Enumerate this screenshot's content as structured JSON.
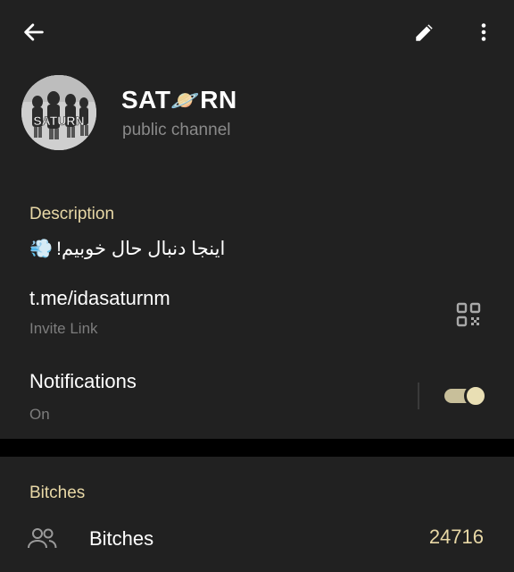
{
  "header": {
    "back_icon": "arrow-left-icon",
    "edit_icon": "pencil-icon",
    "more_icon": "more-vertical-icon",
    "title_part1": "SAT",
    "title_emoji": "🪐",
    "title_part2": "RN",
    "subtitle": "public channel",
    "avatar_text": "SATURN"
  },
  "info": {
    "description_heading": "Description",
    "description_text": "اینجا دنبال حال خوبیم!",
    "description_emoji": "💨",
    "link": "t.me/idasaturnm",
    "link_caption": "Invite Link",
    "qr_icon": "qr-code-icon",
    "notifications_label": "Notifications",
    "notifications_state": "On",
    "notifications_enabled": true
  },
  "members": {
    "heading": "Bitches",
    "icon": "people-icon",
    "label": "Bitches",
    "count": "24716"
  },
  "colors": {
    "background": "#212121",
    "accent": "#e8d8a6",
    "secondary_text": "#8a8a8a"
  }
}
